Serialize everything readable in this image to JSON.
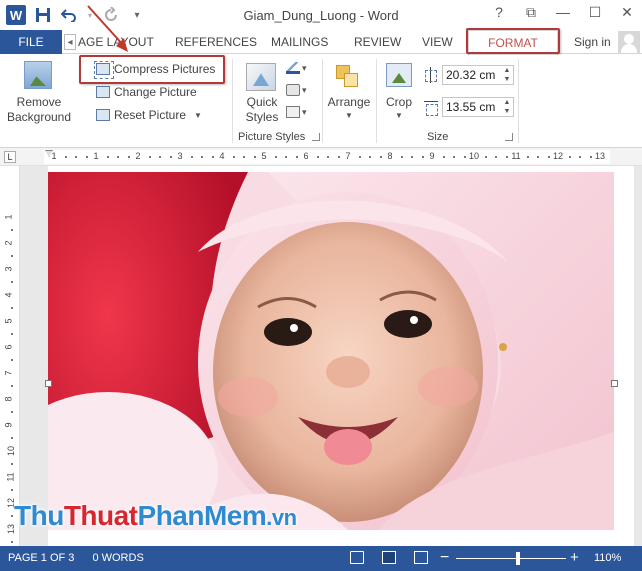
{
  "window": {
    "title": "Giam_Dung_Luong - Word",
    "help": "?",
    "restore": "⧉",
    "minimize": "—",
    "maximize": "☐",
    "close": "✕"
  },
  "qat": {
    "app_logo": "W",
    "save_icon": "save-icon",
    "undo_icon": "undo-icon",
    "redo_icon": "redo-icon",
    "customize_icon": "customize-qat-icon"
  },
  "tabs": {
    "file": "FILE",
    "page_layout": "AGE LAYOUT",
    "references": "REFERENCES",
    "mailings": "MAILINGS",
    "review": "REVIEW",
    "view": "VIEW",
    "format": "FORMAT",
    "sign_in": "Sign in",
    "scroll_left": "◂"
  },
  "ribbon": {
    "remove_background": "Remove Background",
    "compress_pictures": "Compress Pictures",
    "change_picture": "Change Picture",
    "reset_picture": "Reset Picture",
    "quick_styles": "Quick Styles",
    "picture_styles_group": "Picture Styles",
    "arrange": "Arrange",
    "crop": "Crop",
    "height_value": "20.32 cm",
    "width_value": "13.55 cm",
    "size_group": "Size"
  },
  "ruler": {
    "tab_selector": "L",
    "numbers": [
      "1",
      "1",
      "2",
      "3",
      "4",
      "5",
      "6",
      "7",
      "8",
      "9",
      "10",
      "11",
      "12",
      "13"
    ],
    "vnumbers": [
      "1",
      "2",
      "3",
      "4",
      "5",
      "6",
      "7",
      "8",
      "9",
      "10",
      "11",
      "12",
      "13"
    ]
  },
  "watermark": {
    "part1": "Thu",
    "part2": "Thuat",
    "part3": "PhanMem",
    "part4": ".vn"
  },
  "status": {
    "page": "PAGE 1 OF 3",
    "words": "0 WORDS",
    "zoom_minus": "−",
    "zoom_plus": "+",
    "zoom_level": "110%"
  },
  "colors": {
    "brand": "#2b579a",
    "format_tab": "#c0504d",
    "highlight": "#b03a3a"
  }
}
